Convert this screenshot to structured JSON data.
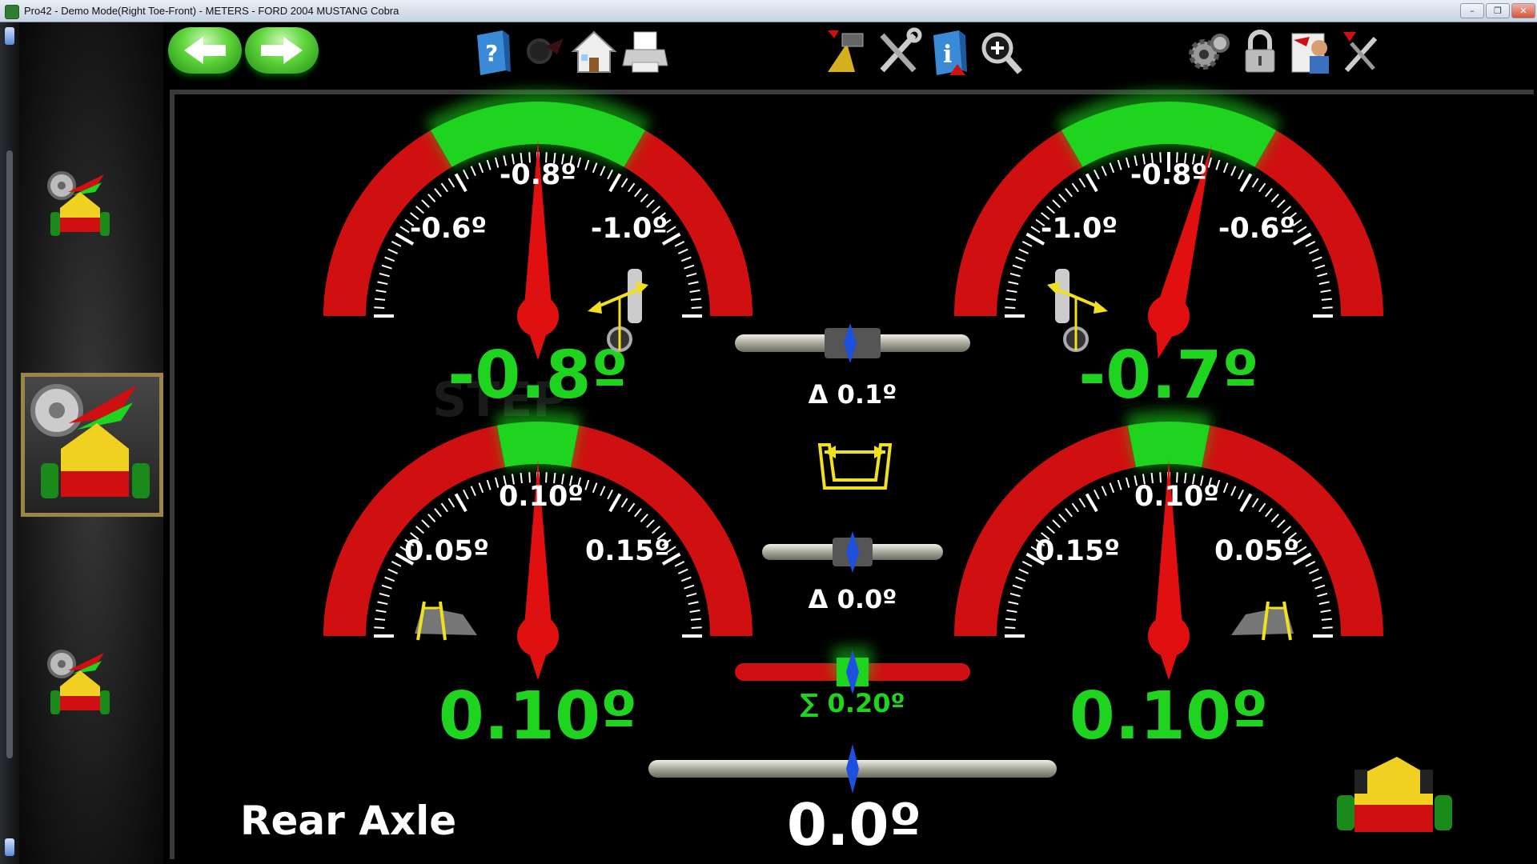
{
  "window": {
    "title": "Pro42 - Demo Mode(Right Toe-Front) - METERS - FORD 2004 MUSTANG Cobra",
    "controls": [
      "minimize-icon",
      "restore-icon",
      "close-icon"
    ]
  },
  "toolbar": {
    "nav": [
      "back-arrow-icon",
      "forward-arrow-icon"
    ],
    "group1": [
      "help-icon",
      "vehicle-icon",
      "home-icon",
      "print-icon"
    ],
    "group2": [
      "measure-icon",
      "tools-icon",
      "info-icon",
      "zoom-icon"
    ],
    "group3": [
      "settings-icon",
      "lock-icon",
      "customer-icon",
      "adjust-icon"
    ]
  },
  "sidebar": {
    "items": [
      "front-axle-view-icon",
      "rear-axle-view-icon",
      "thrust-view-icon"
    ],
    "selected_index": 1
  },
  "gauges": {
    "camber_left": {
      "ticks": [
        "-0.6º",
        "-0.8º",
        "-1.0º"
      ],
      "reading": "-0.8º"
    },
    "camber_right": {
      "ticks": [
        "-1.0º",
        "-0.8º",
        "-0.6º"
      ],
      "reading": "-0.7º"
    },
    "toe_left": {
      "ticks": [
        "0.05º",
        "0.10º",
        "0.15º"
      ],
      "reading": "0.10º"
    },
    "toe_right": {
      "ticks": [
        "0.15º",
        "0.10º",
        "0.05º"
      ],
      "reading": "0.10º"
    }
  },
  "center": {
    "camber_delta": "Δ 0.1º",
    "toe_delta": "Δ 0.0º",
    "total_toe": "∑ 0.20º",
    "thrust_angle": "0.0º"
  },
  "axle_label": "Rear Axle",
  "colors": {
    "in_spec": "#1ed41e",
    "out_of_spec": "#d01010",
    "frame": "#9c8645",
    "needle": "#e01010"
  }
}
